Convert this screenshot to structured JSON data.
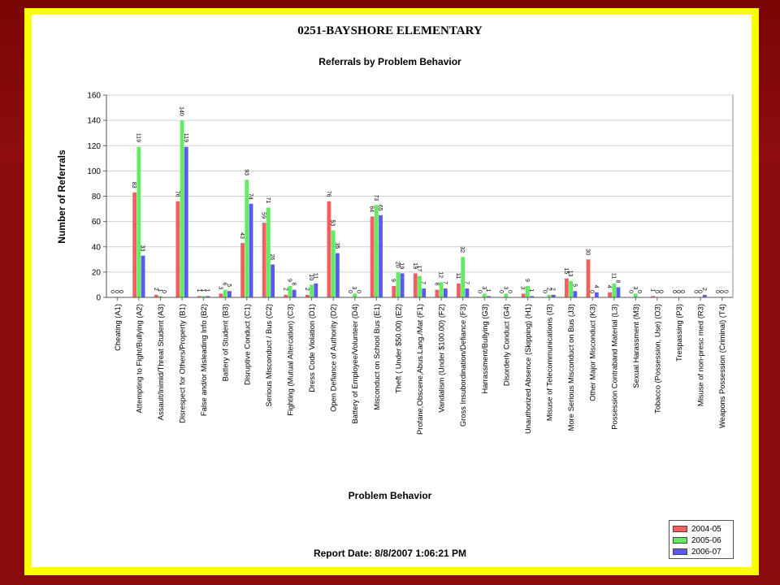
{
  "header": {
    "school": "0251-BAYSHORE ELEMENTARY",
    "report_date": "Report Date: 8/8/2007 1:06:21 PM"
  },
  "colors": {
    "series_2004_05": "#f06060",
    "series_2005_06": "#60ee60",
    "series_2006_07": "#5a5af0",
    "frame": "#ffff00",
    "background": "#8b0a0a"
  },
  "chart_data": {
    "type": "bar",
    "title": "Referrals by Problem Behavior",
    "xlabel": "Problem Behavior",
    "ylabel": "Number of Referrals",
    "ylim": [
      0,
      160
    ],
    "yticks": [
      0,
      20,
      40,
      60,
      80,
      100,
      120,
      140,
      160
    ],
    "grid": true,
    "legend_position": "bottom-right",
    "categories": [
      "Cheating (A1)",
      "Attempting to Fight/Bullying (A2)",
      "Assault/Inimid/Threat  Student (A3)",
      "Disrespect for Others/Property (B1)",
      "False and/or Misleading Info (B2)",
      "Battery of Student (B3)",
      "Disruptive Conduct (C1)",
      "Serious Misconduct / Bus (C2)",
      "Fighting (Mutual Altercation) (C3)",
      "Dress Code Violation (D1)",
      "Open Defiance of Authority (D2)",
      "Battery of Employee/Volunteer (D4)",
      "Misconduct on School Bus (E1)",
      "Theft ( Under $50.00) (E2)",
      "Profane,Obscene,Abus.Lang./Mat (F1)",
      "Vandalism (Under $100.00) (F2)",
      "Gross Insubordination/Defiance (F3)",
      "Harrassment/Bullying (G3)",
      "Disorderly Conduct (G4)",
      "Unauthorized Absence (Skipping) (H1)",
      "Misuse of Telecommunications (I3)",
      "More Serious Misconduct on Bus (J3)",
      "Other Major Misconduct (K3)",
      "Possession Contraband Material (L3)",
      "Sexual Harassment (M3)",
      "Tobacco (Possession, Use) (O3)",
      "Trespassing (P3)",
      "Misuse of non-presc med (R3)",
      "Weapons Possession (Criminal) (T4)"
    ],
    "series": [
      {
        "name": "2004-05",
        "values": [
          0,
          83,
          2,
          76,
          1,
          3,
          43,
          59,
          2,
          2,
          76,
          0,
          64,
          9,
          19,
          6,
          11,
          0,
          0,
          3,
          0,
          15,
          30,
          4,
          0,
          1,
          0,
          0,
          0
        ]
      },
      {
        "name": "2005-06",
        "values": [
          0,
          119,
          1,
          140,
          1,
          6,
          93,
          71,
          9,
          10,
          53,
          3,
          73,
          20,
          17,
          12,
          32,
          3,
          3,
          9,
          2,
          13,
          0,
          11,
          3,
          0,
          0,
          0,
          0
        ]
      },
      {
        "name": "2006-07",
        "values": [
          0,
          33,
          0,
          119,
          1,
          5,
          74,
          26,
          6,
          11,
          35,
          0,
          65,
          19,
          7,
          7,
          7,
          1,
          0,
          1,
          2,
          5,
          4,
          8,
          0,
          0,
          0,
          2,
          0
        ]
      }
    ]
  }
}
